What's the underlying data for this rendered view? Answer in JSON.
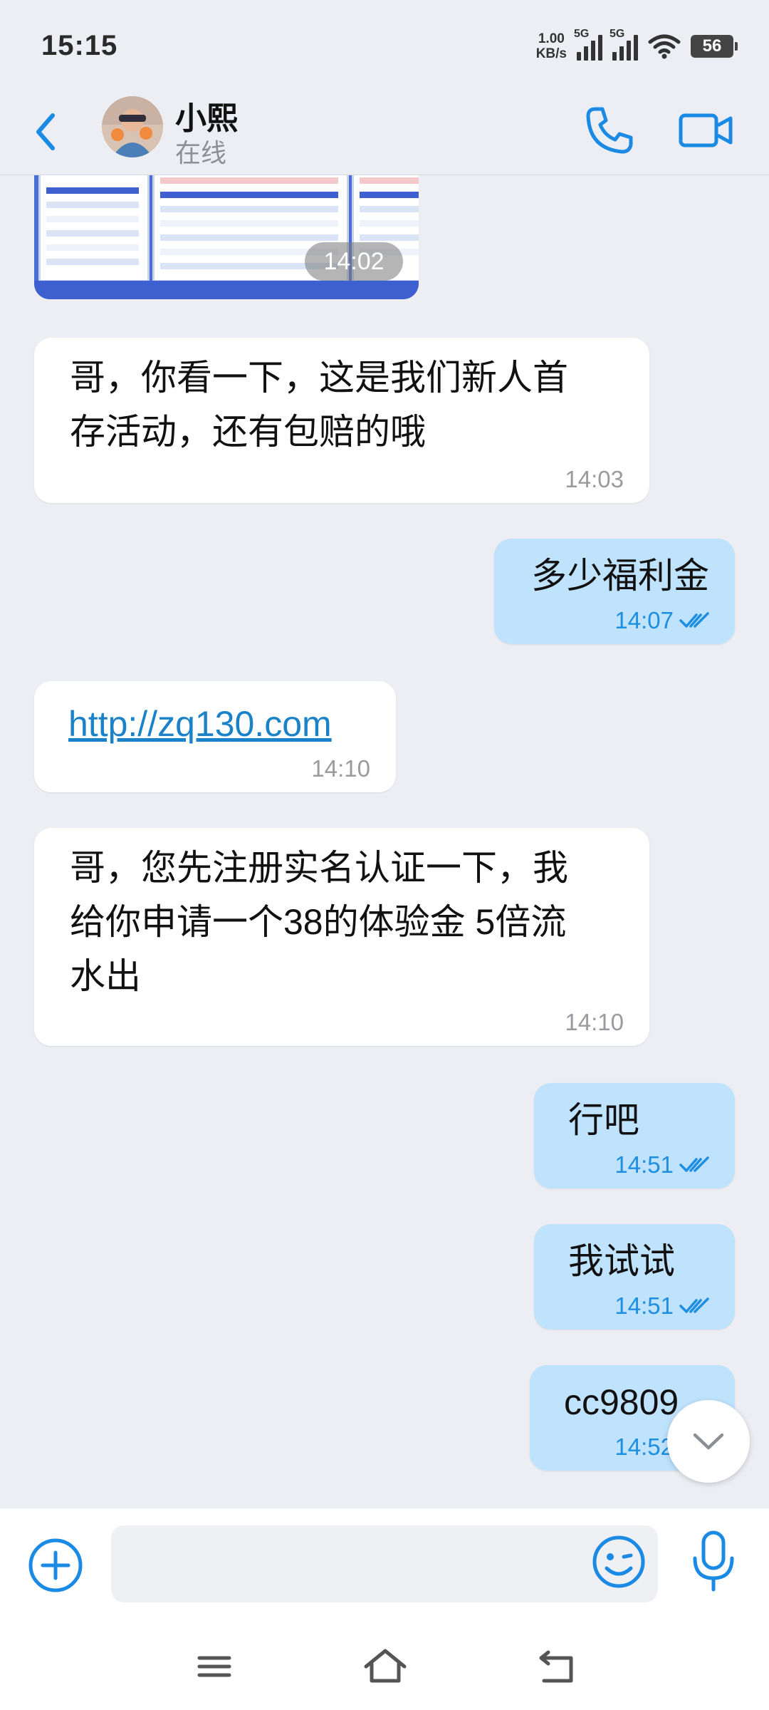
{
  "status_bar": {
    "time": "15:15",
    "network_speed_value": "1.00",
    "network_speed_unit": "KB/s",
    "sim1_label": "5G",
    "sim2_label": "5G",
    "battery": "56"
  },
  "header": {
    "contact_name": "小熙",
    "presence": "在线",
    "icons": [
      "back-arrow-icon",
      "phone-icon",
      "video-camera-icon"
    ],
    "accent_color": "#1a8ae5"
  },
  "messages": [
    {
      "type": "image",
      "direction": "in",
      "time": "14:02"
    },
    {
      "type": "text",
      "direction": "in",
      "text_line1": "哥，你看一下，这是我们新人首",
      "text_line2": "存活动，还有包赔的哦",
      "time": "14:03"
    },
    {
      "type": "text",
      "direction": "out",
      "text": "多少福利金",
      "time": "14:07",
      "read": true
    },
    {
      "type": "link",
      "direction": "in",
      "text": "http://zq130.com",
      "time": "14:10"
    },
    {
      "type": "text",
      "direction": "in",
      "text_line1": "哥，您先注册实名认证一下，我",
      "text_line2": "给你申请一个38的体验金 5倍流",
      "text_line3": "水出",
      "time": "14:10"
    },
    {
      "type": "text",
      "direction": "out",
      "text": "行吧",
      "time": "14:51",
      "read": true
    },
    {
      "type": "text",
      "direction": "out",
      "text": "我试试",
      "time": "14:51",
      "read": true
    },
    {
      "type": "text",
      "direction": "out",
      "text": "cc9809",
      "time": "14:52",
      "read": true
    }
  ],
  "input_bar": {
    "icons": [
      "plus-icon",
      "emoji-icon",
      "microphone-icon"
    ],
    "placeholder": ""
  },
  "nav_bar": {
    "icons": [
      "menu-icon",
      "home-icon",
      "back-icon"
    ]
  },
  "colors": {
    "chat_background": "#eceef3",
    "incoming_bubble": "#ffffff",
    "outgoing_bubble": "#bfe2fd",
    "link": "#1a82c9"
  }
}
